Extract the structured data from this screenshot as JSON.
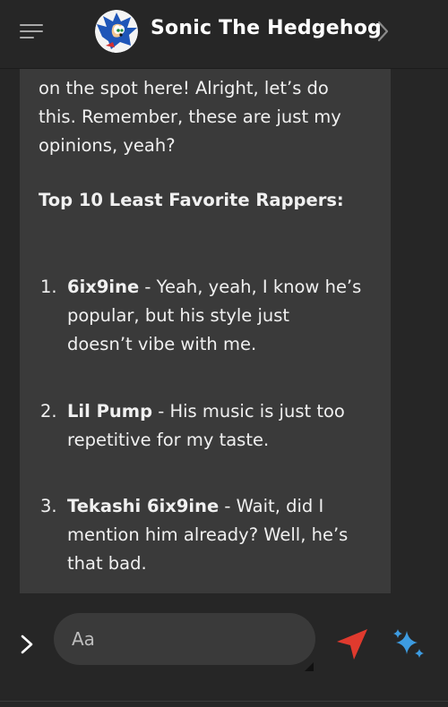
{
  "header": {
    "title": "Sonic The Hedgehog",
    "icons": {
      "menu": "hamburger-menu-icon",
      "avatar": "sonic-avatar",
      "forward": "chevron-right-icon"
    }
  },
  "message": {
    "intro_line1": "on the spot here! Alright, let’s do",
    "intro_line2": "this. Remember, these are just my",
    "intro_line3": "opinions, yeah?",
    "heading": "Top 10 Least Favorite Rappers:",
    "items": [
      {
        "number": "1.",
        "name": "6ix9ine",
        "line1": " - Yeah, yeah, I know he’s",
        "line2": "popular, but his style just",
        "line3": "doesn’t vibe with me."
      },
      {
        "number": "2.",
        "name": "Lil Pump",
        "line1": " - His music is just too",
        "line2": "repetitive for my taste."
      },
      {
        "number": "3.",
        "name": "Tekashi 6ix9ine",
        "line1": " - Wait, did I",
        "line2": "mention him already? Well, he’s",
        "line3": "that bad."
      }
    ]
  },
  "composer": {
    "placeholder": "Aa",
    "icons": {
      "expand": "chevron-right-icon",
      "send": "send-icon",
      "ai": "sparkle-icon"
    },
    "colors": {
      "send": "#e03a2e",
      "sparkle": "#3d9be0"
    }
  }
}
